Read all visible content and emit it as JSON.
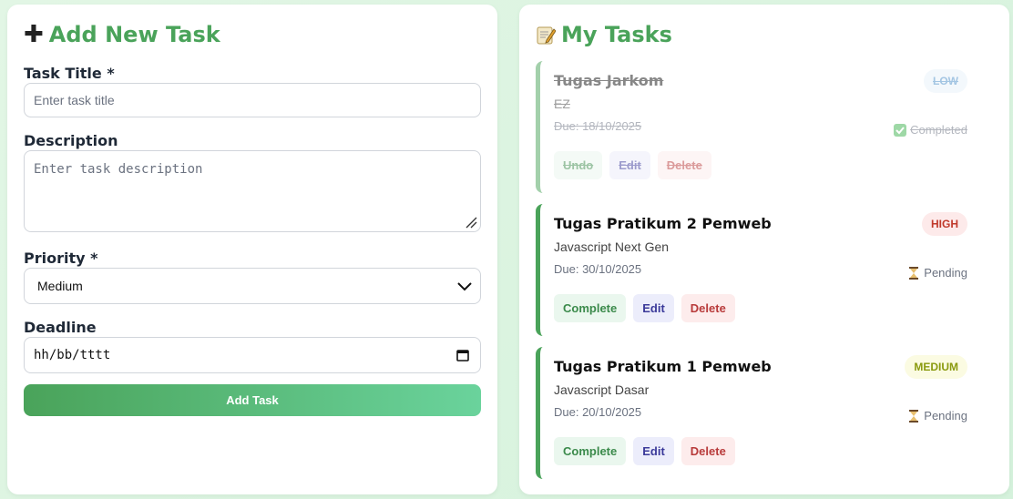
{
  "form": {
    "title": "Add New Task",
    "icon": "plus-icon",
    "task_title_label": "Task Title *",
    "task_title_placeholder": "Enter task title",
    "description_label": "Description",
    "description_placeholder": "Enter task description",
    "priority_label": "Priority *",
    "priority_value": "Medium",
    "deadline_label": "Deadline",
    "deadline_value": "hh/bb/tttt",
    "submit_label": "Add Task"
  },
  "list": {
    "title": "My Tasks",
    "icon": "memo-icon",
    "tasks": [
      {
        "title": "Tugas Jarkom",
        "description": "EZ",
        "due": "Due: 18/10/2025",
        "priority": "LOW",
        "status": "Completed",
        "status_icon": "check-icon",
        "actions": [
          "Undo",
          "Edit",
          "Delete"
        ]
      },
      {
        "title": "Tugas Pratikum 2 Pemweb",
        "description": "Javascript Next Gen",
        "due": "Due: 30/10/2025",
        "priority": "HIGH",
        "status": "Pending",
        "status_icon": "hourglass-icon",
        "actions": [
          "Complete",
          "Edit",
          "Delete"
        ]
      },
      {
        "title": "Tugas Pratikum 1 Pemweb",
        "description": "Javascript Dasar",
        "due": "Due: 20/10/2025",
        "priority": "MEDIUM",
        "status": "Pending",
        "status_icon": "hourglass-icon",
        "actions": [
          "Complete",
          "Edit",
          "Delete"
        ]
      }
    ]
  },
  "colors": {
    "accent": "#4aa35a",
    "background": "#d8f3dc",
    "high": "#c0392b",
    "low": "#4b8ec8",
    "medium": "#8a9a0f"
  }
}
